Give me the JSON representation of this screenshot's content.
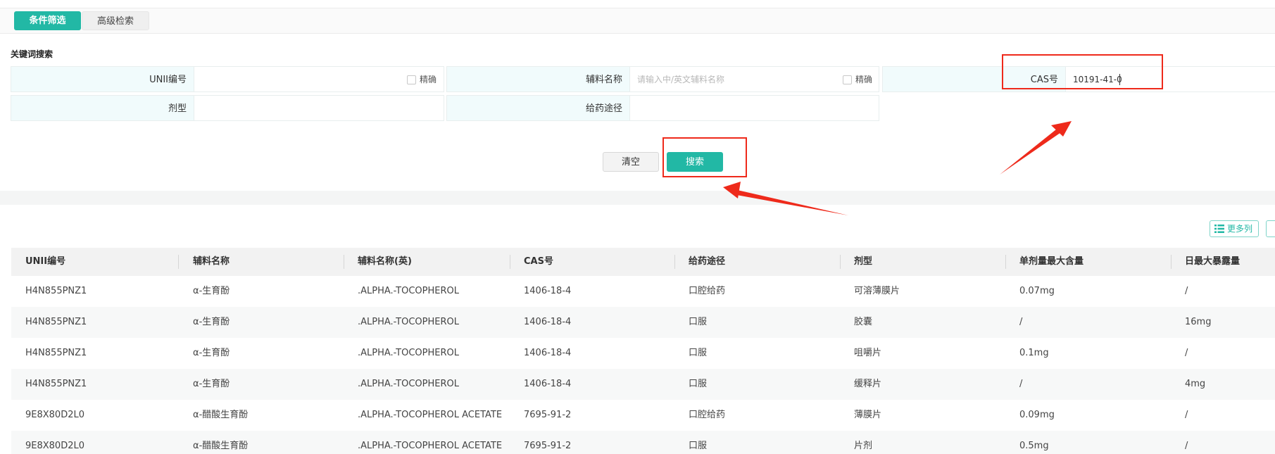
{
  "tabs": {
    "active": "条件筛选",
    "inactive": "高级检索"
  },
  "section_title": "关键词搜索",
  "filters": {
    "unii": {
      "label": "UNII编号",
      "value": "",
      "exact_label": "精确"
    },
    "excipient": {
      "label": "辅料名称",
      "placeholder": "请输入中/英文辅料名称",
      "exact_label": "精确"
    },
    "cas": {
      "label": "CAS号",
      "value": "10191-41-0"
    },
    "dosage_form": {
      "label": "剂型",
      "value": ""
    },
    "route": {
      "label": "给药途径",
      "value": ""
    }
  },
  "buttons": {
    "clear": "清空",
    "search": "搜索",
    "more_columns": "更多列"
  },
  "table": {
    "headers": [
      "UNII编号",
      "辅料名称",
      "辅料名称(英)",
      "CAS号",
      "给药途径",
      "剂型",
      "单剂量最大含量",
      "日最大暴露量"
    ],
    "rows": [
      [
        "H4N855PNZ1",
        "α-生育酚",
        ".ALPHA.-TOCOPHEROL",
        "1406-18-4",
        "口腔给药",
        "可溶薄膜片",
        "0.07mg",
        "/"
      ],
      [
        "H4N855PNZ1",
        "α-生育酚",
        ".ALPHA.-TOCOPHEROL",
        "1406-18-4",
        "口服",
        "胶囊",
        "/",
        "16mg"
      ],
      [
        "H4N855PNZ1",
        "α-生育酚",
        ".ALPHA.-TOCOPHEROL",
        "1406-18-4",
        "口服",
        "咀嚼片",
        "0.1mg",
        "/"
      ],
      [
        "H4N855PNZ1",
        "α-生育酚",
        ".ALPHA.-TOCOPHEROL",
        "1406-18-4",
        "口服",
        "缓释片",
        "/",
        "4mg"
      ],
      [
        "9E8X80D2L0",
        "α-醋酸生育酚",
        ".ALPHA.-TOCOPHEROL ACETATE",
        "7695-91-2",
        "口腔给药",
        "薄膜片",
        "0.09mg",
        "/"
      ],
      [
        "9E8X80D2L0",
        "α-醋酸生育酚",
        ".ALPHA.-TOCOPHEROL ACETATE",
        "7695-91-2",
        "口服",
        "片剂",
        "0.5mg",
        "/"
      ]
    ]
  },
  "colors": {
    "accent": "#22b8a5",
    "annotation": "#ee2a1b"
  },
  "icons": {
    "more_columns": "list-icon"
  }
}
